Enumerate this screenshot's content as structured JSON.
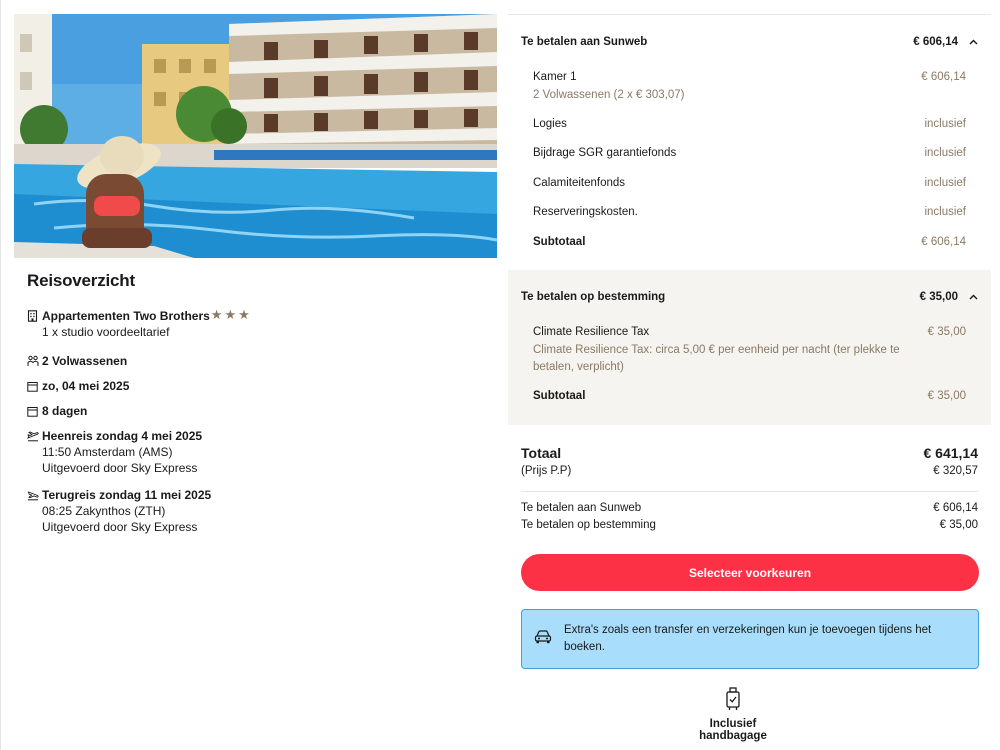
{
  "overview": {
    "title": "Reisoverzicht",
    "hotel_name": "Appartementen Two Brothers",
    "hotel_stars": 3,
    "room": "1 x studio voordeeltarief",
    "travelers": "2 Volwassenen",
    "date": "zo, 04 mei 2025",
    "duration": "8 dagen",
    "outbound": {
      "title": "Heenreis zondag 4 mei 2025",
      "detail": "11:50 Amsterdam (AMS)",
      "carrier": "Uitgevoerd door Sky Express"
    },
    "return": {
      "title": "Terugreis zondag 11 mei 2025",
      "detail": "08:25 Zakynthos (ZTH)",
      "carrier": "Uitgevoerd door Sky Express"
    }
  },
  "sunweb": {
    "label": "Te betalen aan Sunweb",
    "amount": "€ 606,14",
    "room_label": "Kamer 1",
    "room_amount": "€ 606,14",
    "room_sub": "2 Volwassenen (2 x € 303,07)",
    "items": [
      {
        "label": "Logies",
        "value": "inclusief"
      },
      {
        "label": "Bijdrage SGR garantiefonds",
        "value": "inclusief"
      },
      {
        "label": "Calamiteitenfonds",
        "value": "inclusief"
      },
      {
        "label": "Reserveringskosten.",
        "value": "inclusief"
      }
    ],
    "subtotal_label": "Subtotaal",
    "subtotal": "€ 606,14"
  },
  "destination": {
    "label": "Te betalen op bestemming",
    "amount": "€ 35,00",
    "item_label": "Climate Resilience Tax",
    "item_amount": "€ 35,00",
    "item_note_1": "Climate Resilience Tax: circa 5,00 € per eenheid per nacht (ter plekke te",
    "item_note_2": "betalen, verplicht)",
    "subtotal_label": "Subtotaal",
    "subtotal": "€ 35,00"
  },
  "totals": {
    "total_label": "Totaal",
    "total": "€ 641,14",
    "pp_label": "(Prijs P.P)",
    "pp": "€ 320,57",
    "sunweb_label": "Te betalen aan Sunweb",
    "sunweb": "€ 606,14",
    "dest_label": "Te betalen op bestemming",
    "dest": "€ 35,00"
  },
  "cta_label": "Selecteer voorkeuren",
  "info_1": "Extra's zoals een transfer en verzekeringen kun je toevoegen tijdens het",
  "info_2": "boeken.",
  "baggage_label": "Inclusief handbagage",
  "colors": {
    "accent": "#fc3146",
    "muted": "#8a7a66",
    "info_bg": "#a8defb",
    "info_border": "#3aa0e0",
    "panel_bg": "#f6f4f0"
  },
  "icons": [
    "building-icon",
    "star-icon",
    "people-icon",
    "calendar-icon",
    "plane-takeoff-icon",
    "plane-landing-icon",
    "chevron-up-icon",
    "car-icon",
    "luggage-icon"
  ]
}
